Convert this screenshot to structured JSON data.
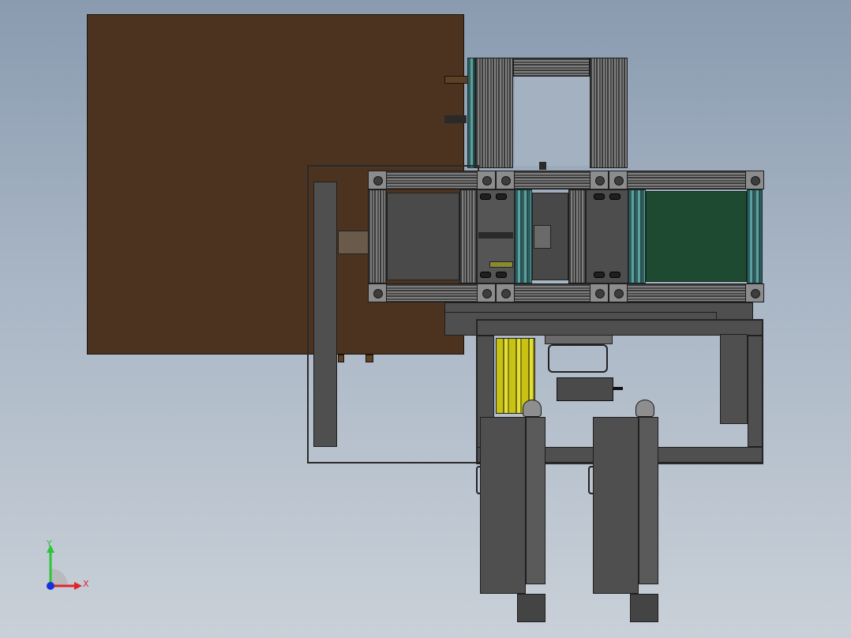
{
  "viewport": {
    "background_top": "#8a9bb0",
    "background_bottom": "#c9d0d8",
    "model_colors": {
      "wood_panel": "#4b3320",
      "aluminum_profile": "#7d7d7d",
      "steel_frame": "#4f4f4f",
      "green_conveyor": "#1e4a31",
      "yellow_roller": "#c8c214"
    }
  },
  "triad": {
    "y_label": "Y",
    "x_label": "X",
    "y_color": "#2dc43a",
    "x_color": "#e0242a",
    "z_color": "#1432d8"
  }
}
